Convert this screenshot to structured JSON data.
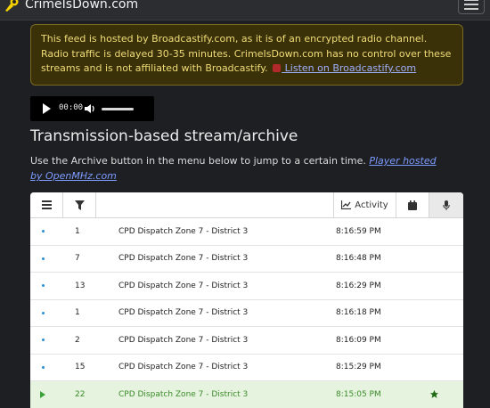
{
  "site": {
    "title": "CrimeIsDown.com"
  },
  "alert": {
    "text": "This feed is hosted by Broadcastify.com, as it is of an encrypted radio channel. Radio traffic is delayed 30-35 minutes. CrimeIsDown.com has no control over these streams and is not affiliated with Broadcastify.",
    "link_text": " Listen on Broadcastify.com"
  },
  "player": {
    "time": "00:00"
  },
  "section": {
    "title": "Transmission-based stream/archive",
    "description": "Use the Archive button in the menu below to jump to a certain time.",
    "link_text": "Player hosted by OpenMHz.com"
  },
  "table": {
    "header": {
      "activity_label": "Activity"
    },
    "rows": [
      {
        "id": "1",
        "talkgroup": "CPD Dispatch Zone 7 - District 3",
        "time": "8:16:59 PM",
        "state": "dot",
        "starred": false
      },
      {
        "id": "7",
        "talkgroup": "CPD Dispatch Zone 7 - District 3",
        "time": "8:16:48 PM",
        "state": "dot",
        "starred": false
      },
      {
        "id": "13",
        "talkgroup": "CPD Dispatch Zone 7 - District 3",
        "time": "8:16:29 PM",
        "state": "dot",
        "starred": false
      },
      {
        "id": "1",
        "talkgroup": "CPD Dispatch Zone 7 - District 3",
        "time": "8:16:18 PM",
        "state": "dot",
        "starred": false
      },
      {
        "id": "2",
        "talkgroup": "CPD Dispatch Zone 7 - District 3",
        "time": "8:16:09 PM",
        "state": "dot",
        "starred": false
      },
      {
        "id": "15",
        "talkgroup": "CPD Dispatch Zone 7 - District 3",
        "time": "8:15:29 PM",
        "state": "dot",
        "starred": false
      },
      {
        "id": "22",
        "talkgroup": "CPD Dispatch Zone 7 - District 3",
        "time": "8:15:05 PM",
        "state": "playing",
        "starred": true
      }
    ]
  },
  "icons": {
    "brand": "mic-logo-icon",
    "menu": "hamburger-icon",
    "filter": "filter-icon",
    "activity": "line-chart-icon",
    "calendar": "calendar-icon",
    "mic": "microphone-icon",
    "star": "star-icon"
  },
  "colors": {
    "accent": "#2a8fd6",
    "active_row": "#e6f4df",
    "playing": "#3aa13a",
    "alert_bg": "#3a3108"
  }
}
